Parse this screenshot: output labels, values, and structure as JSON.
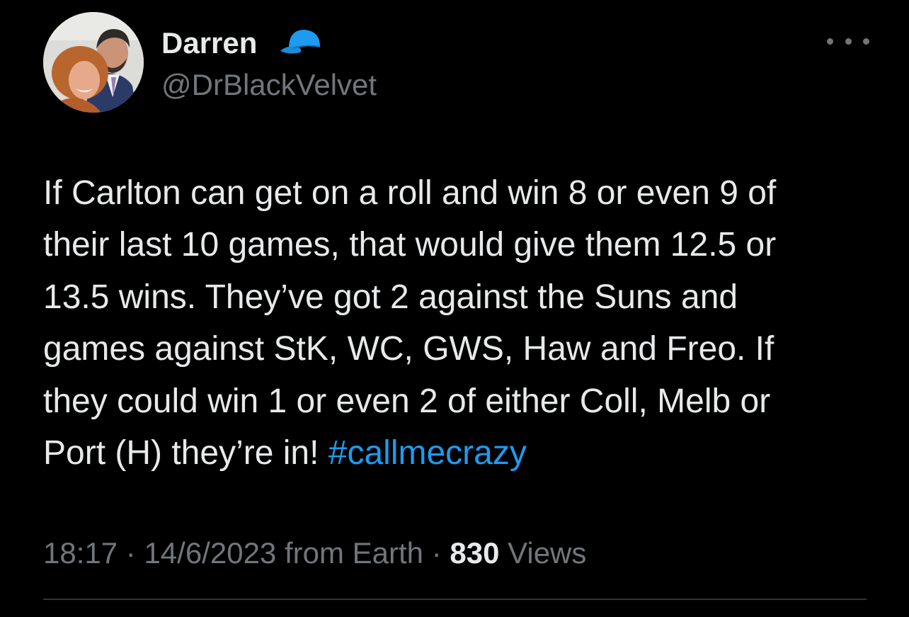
{
  "author": {
    "display_name": "Darren",
    "handle": "@DrBlackVelvet",
    "badge_icon": "cap-icon",
    "badge_color": "#1d9bf0"
  },
  "more_icon": "more-icon",
  "tweet": {
    "lines": [
      "If Carlton can get on a roll and win 8 or even 9 of",
      "their last 10 games, that would give them 12.5 or",
      "13.5 wins. They’ve got 2 against the Suns and",
      "games against StK, WC, GWS, Haw and Freo. If",
      "they could win 1 or even 2 of either Coll, Melb or"
    ],
    "last_line_text": "Port (H) they’re in! ",
    "hashtag": "#callmecrazy"
  },
  "meta": {
    "time": "18:17",
    "separator": " · ",
    "date": "14/6/2023",
    "source": " from Earth",
    "views_count": "830",
    "views_label": " Views"
  },
  "colors": {
    "background": "#000000",
    "text_primary": "#e7e9ea",
    "text_secondary": "#71767b",
    "link": "#1d9bf0",
    "divider": "#2f3336"
  }
}
